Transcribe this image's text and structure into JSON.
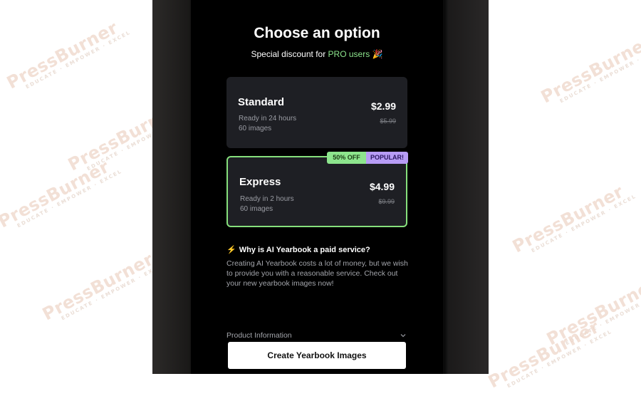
{
  "watermark": {
    "brand": "PressBurner",
    "tagline": "EDUCATE · EMPOWER · EXCEL"
  },
  "header": {
    "title": "Choose an option",
    "subtitle_prefix": "Special discount for ",
    "subtitle_highlight": "PRO users",
    "subtitle_emoji": "🎉"
  },
  "plans": [
    {
      "name": "Standard",
      "ready": "Ready in 24 hours",
      "images": "60 images",
      "price": "$2.99",
      "old_price": "$5.99"
    },
    {
      "name": "Express",
      "ready": "Ready in 2 hours",
      "images": "60 images",
      "price": "$4.99",
      "old_price": "$9.99",
      "badges": [
        "50% OFF",
        "POPULAR!"
      ]
    }
  ],
  "faq": {
    "icon": "lightning-icon",
    "question": "Why is AI Yearbook a paid service?",
    "answer": "Creating AI Yearbook costs a lot of money, but we wish to provide you with a reasonable service. Check out your new yearbook images now!"
  },
  "product_info": {
    "label": "Product Information",
    "icon": "chevron-down-icon"
  },
  "cta": {
    "label": "Create Yearbook Images"
  },
  "colors": {
    "accent_green": "#8de58d",
    "badge_purple": "#b79cf5",
    "card_bg": "#1e1f24",
    "selected_border": "#86e07c"
  }
}
